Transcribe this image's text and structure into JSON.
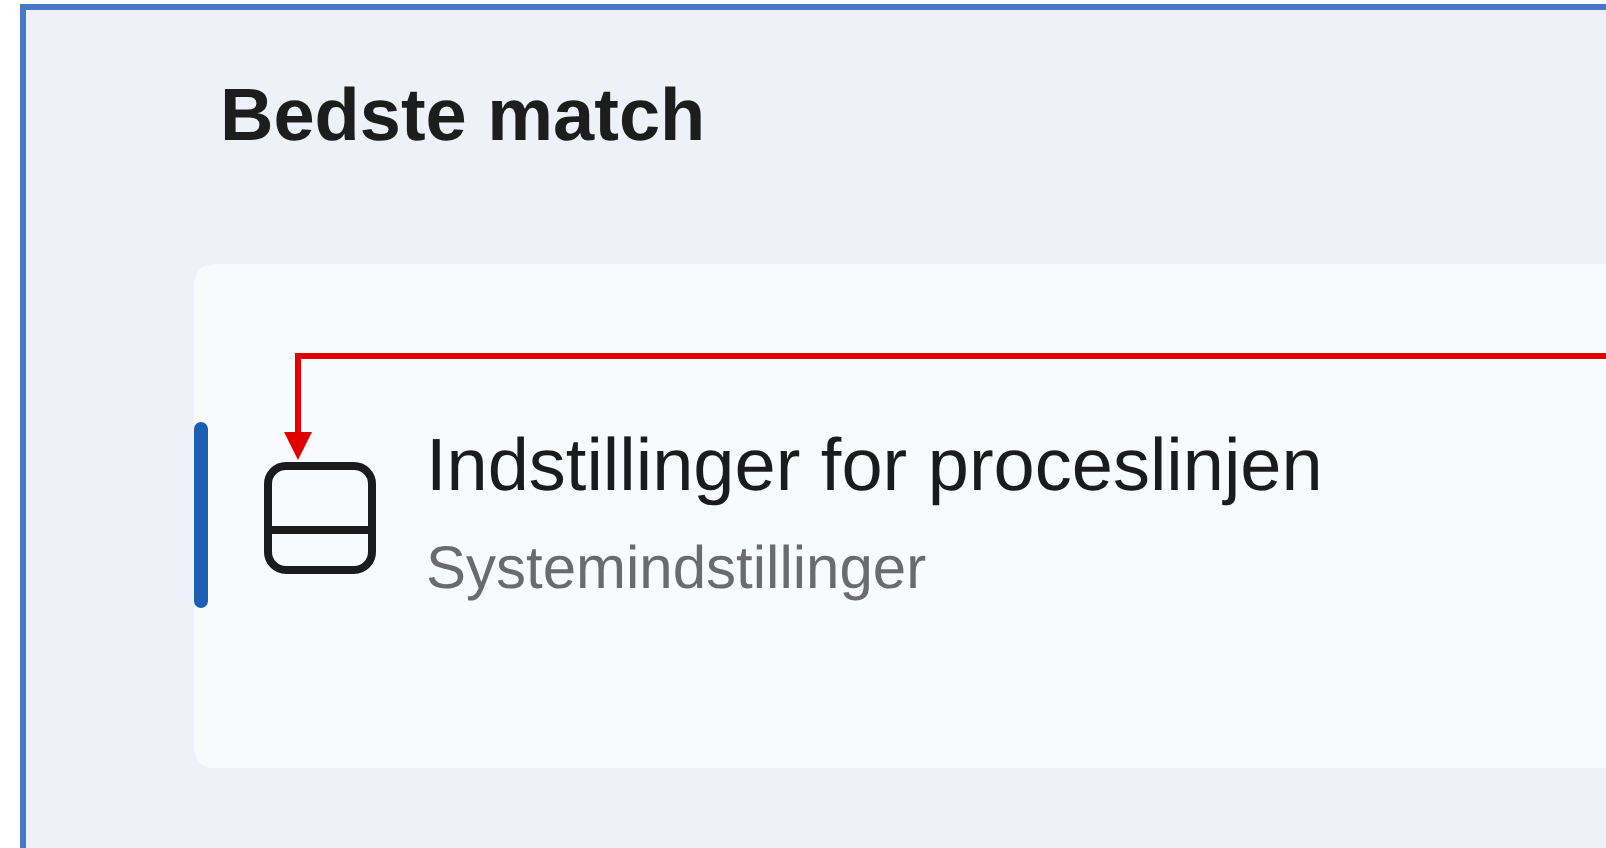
{
  "section": {
    "title": "Bedste match"
  },
  "results": [
    {
      "title": "Indstillinger for proceslinjen",
      "subtitle": "Systemindstillinger",
      "selected": true
    }
  ],
  "annotation": {
    "kind": "arrow",
    "color": "#e00000"
  }
}
